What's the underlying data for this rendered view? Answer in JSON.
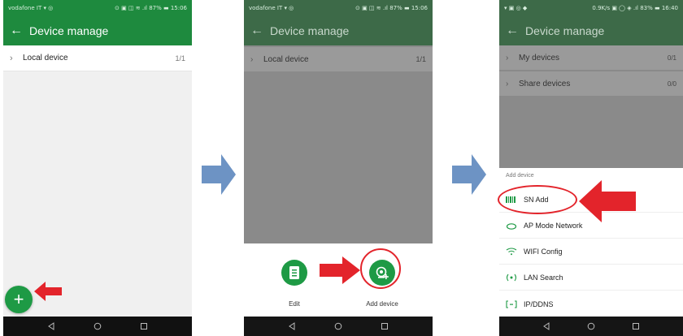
{
  "colors": {
    "appbar": "#1e8a3e",
    "accent": "#1e9a45",
    "highlight_red": "#e3242b",
    "flow_arrow": "#6d93c4"
  },
  "screen1": {
    "status_left": "vodafone IT ▾ ◎",
    "status_right": "⊙ ▣ ◫ ≋ .ıl 87% ▬ 15:06",
    "title": "Device manage",
    "rows": [
      {
        "label": "Local device",
        "count": "1/1"
      }
    ],
    "fab_icon": "plus-icon"
  },
  "screen2": {
    "status_left": "vodafone IT ▾ ◎",
    "status_right": "⊙ ▣ ◫ ≋ .ıl 87% ▬ 15:06",
    "title": "Device manage",
    "rows": [
      {
        "label": "Local device",
        "count": "1/1"
      }
    ],
    "actions": [
      {
        "label": "Edit",
        "icon": "document-icon"
      },
      {
        "label": "Add device",
        "icon": "add-camera-icon"
      }
    ]
  },
  "screen3": {
    "status_left": "▾ ▣ ◎ ◆",
    "status_right": "0.9K/s ▣ ◯ ◈ .ıl 83% ▬ 16:40",
    "title": "Device manage",
    "rows": [
      {
        "label": "My devices",
        "count": "0/1"
      },
      {
        "label": "Share devices",
        "count": "0/0"
      }
    ],
    "sheet_title": "Add device",
    "options": [
      {
        "label": "SN Add",
        "icon": "barcode-icon"
      },
      {
        "label": "AP Mode Network",
        "icon": "cloud-icon"
      },
      {
        "label": "WIFI Config",
        "icon": "wifi-icon"
      },
      {
        "label": "LAN Search",
        "icon": "signal-search-icon"
      },
      {
        "label": "IP/DDNS",
        "icon": "ip-bracket-icon"
      }
    ]
  }
}
